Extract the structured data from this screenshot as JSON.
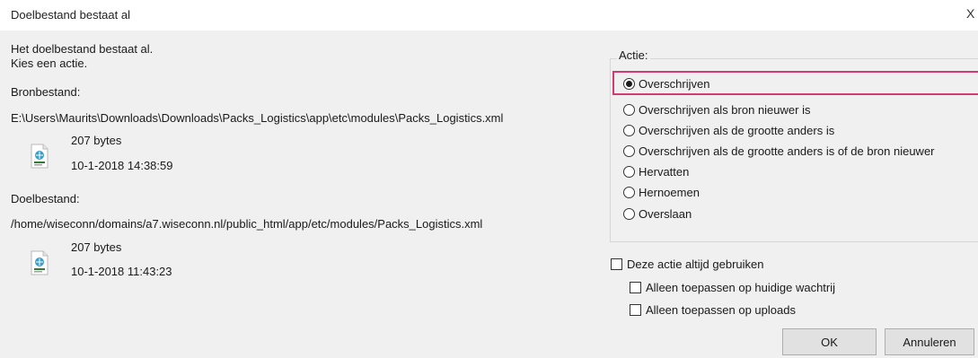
{
  "window": {
    "title": "Doelbestand bestaat al",
    "close_glyph": "X"
  },
  "message": {
    "line1": "Het doelbestand bestaat al.",
    "line2": "Kies een actie."
  },
  "source": {
    "label": "Bronbestand:",
    "path": "E:\\Users\\Maurits\\Downloads\\Downloads\\Packs_Logistics\\app\\etc\\modules\\Packs_Logistics.xml",
    "size": "207 bytes",
    "date": "10-1-2018 14:38:59",
    "icon": "file-icon"
  },
  "target": {
    "label": "Doelbestand:",
    "path": "/home/wiseconn/domains/a7.wiseconn.nl/public_html/app/etc/modules/Packs_Logistics.xml",
    "size": "207 bytes",
    "date": "10-1-2018 11:43:23",
    "icon": "file-icon"
  },
  "action": {
    "group_label": "Actie:",
    "selected": "Overschrijven",
    "options": [
      "Overschrijven",
      "Overschrijven als bron nieuwer is",
      "Overschrijven als de grootte anders is",
      "Overschrijven als de grootte anders is of de bron nieuwer",
      "Hervatten",
      "Hernoemen",
      "Overslaan"
    ]
  },
  "always": {
    "label": "Deze actie altijd gebruiken",
    "queue_label": "Alleen toepassen op huidige wachtrij",
    "uploads_label": "Alleen toepassen op uploads"
  },
  "buttons": {
    "ok": "OK",
    "cancel": "Annuleren"
  },
  "colors": {
    "highlight": "#d23c73",
    "background": "#f0f0f0"
  }
}
